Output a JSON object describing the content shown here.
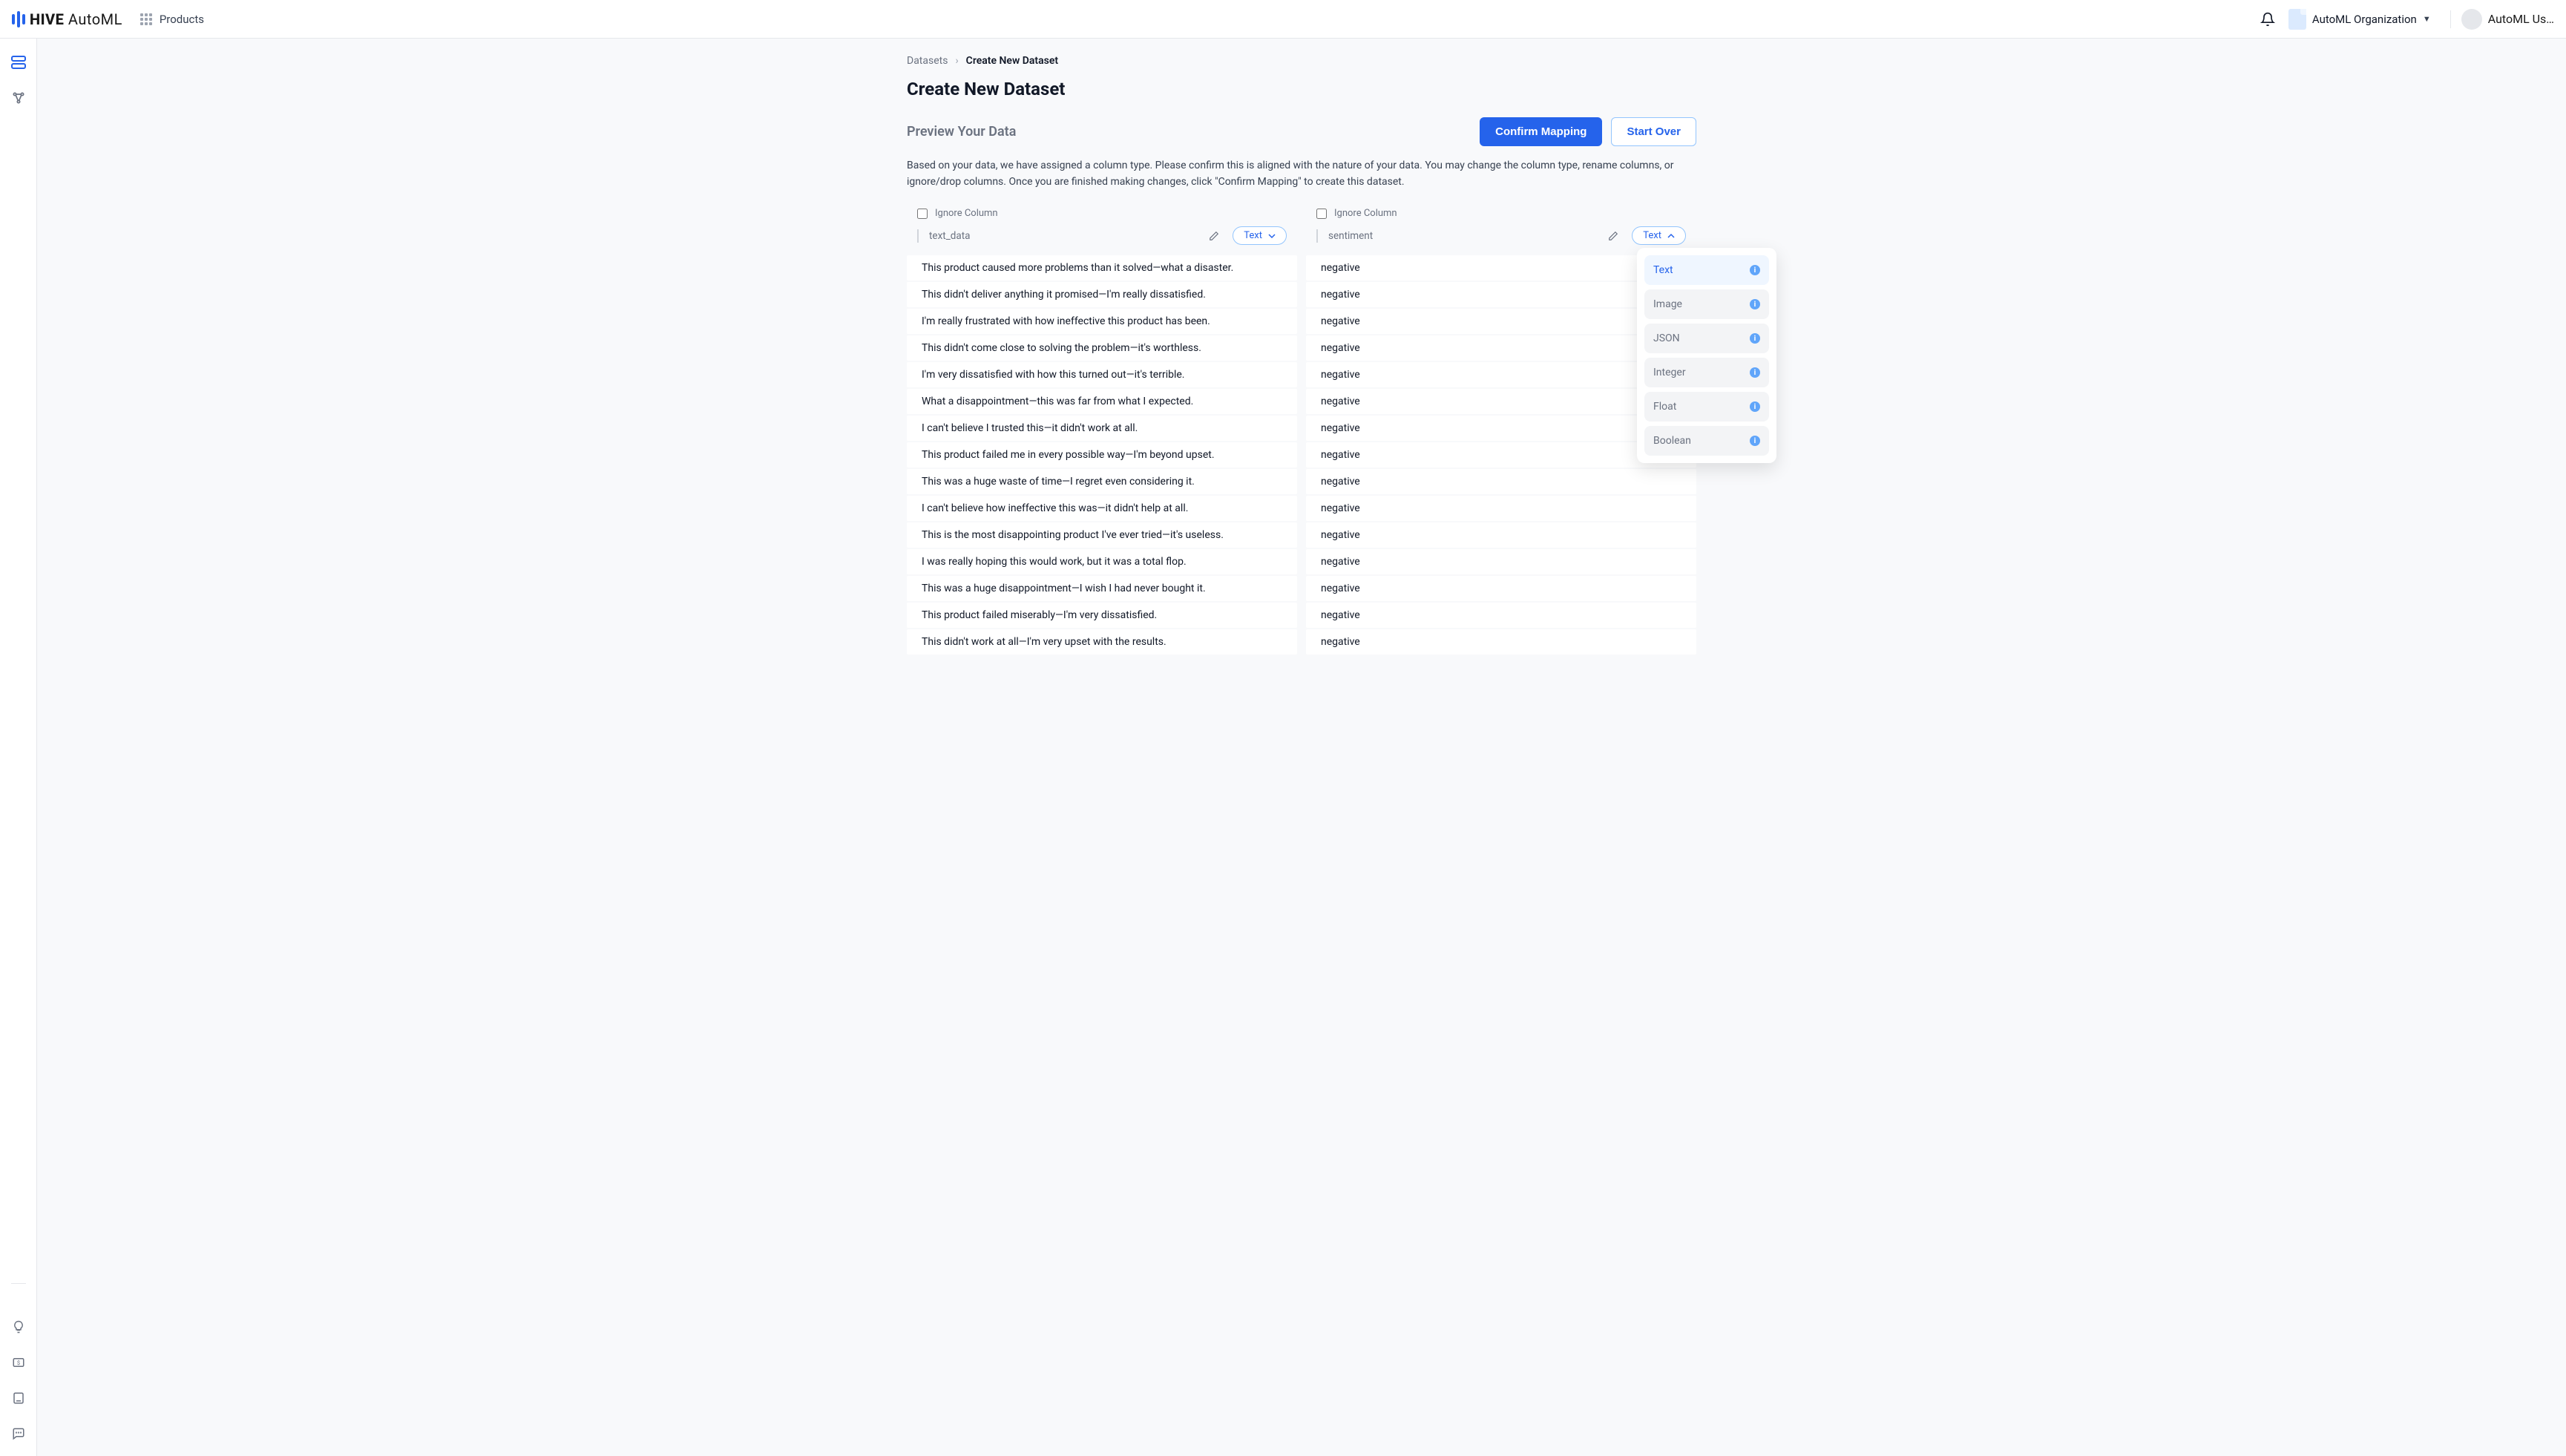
{
  "header": {
    "logo_main": "HIVE",
    "logo_sub": "AutoML",
    "products_label": "Products",
    "org_name": "AutoML Organization",
    "user_name": "AutoML Us…"
  },
  "breadcrumb": {
    "root": "Datasets",
    "current": "Create New Dataset"
  },
  "page_title": "Create New Dataset",
  "section": {
    "title": "Preview Your Data",
    "description": "Based on your data, we have assigned a column type. Please confirm this is aligned with the nature of your data. You may change the column type, rename columns, or ignore/drop columns. Once you are finished making changes, click \"Confirm Mapping\" to create this dataset."
  },
  "buttons": {
    "confirm": "Confirm Mapping",
    "start_over": "Start Over"
  },
  "columns": [
    {
      "ignore_label": "Ignore Column",
      "name": "text_data",
      "type": "Text",
      "open": false
    },
    {
      "ignore_label": "Ignore Column",
      "name": "sentiment",
      "type": "Text",
      "open": true
    }
  ],
  "type_options": [
    "Text",
    "Image",
    "JSON",
    "Integer",
    "Float",
    "Boolean"
  ],
  "rows": [
    {
      "text_data": "This product caused more problems than it solved—what a disaster.",
      "sentiment": "negative"
    },
    {
      "text_data": "This didn't deliver anything it promised—I'm really dissatisfied.",
      "sentiment": "negative"
    },
    {
      "text_data": "I'm really frustrated with how ineffective this product has been.",
      "sentiment": "negative"
    },
    {
      "text_data": "This didn't come close to solving the problem—it's worthless.",
      "sentiment": "negative"
    },
    {
      "text_data": "I'm very dissatisfied with how this turned out—it's terrible.",
      "sentiment": "negative"
    },
    {
      "text_data": "What a disappointment—this was far from what I expected.",
      "sentiment": "negative"
    },
    {
      "text_data": "I can't believe I trusted this—it didn't work at all.",
      "sentiment": "negative"
    },
    {
      "text_data": "This product failed me in every possible way—I'm beyond upset.",
      "sentiment": "negative"
    },
    {
      "text_data": "This was a huge waste of time—I regret even considering it.",
      "sentiment": "negative"
    },
    {
      "text_data": "I can't believe how ineffective this was—it didn't help at all.",
      "sentiment": "negative"
    },
    {
      "text_data": "This is the most disappointing product I've ever tried—it's useless.",
      "sentiment": "negative"
    },
    {
      "text_data": "I was really hoping this would work, but it was a total flop.",
      "sentiment": "negative"
    },
    {
      "text_data": "This was a huge disappointment—I wish I had never bought it.",
      "sentiment": "negative"
    },
    {
      "text_data": "This product failed miserably—I'm very dissatisfied.",
      "sentiment": "negative"
    },
    {
      "text_data": "This didn't work at all—I'm very upset with the results.",
      "sentiment": "negative"
    }
  ]
}
